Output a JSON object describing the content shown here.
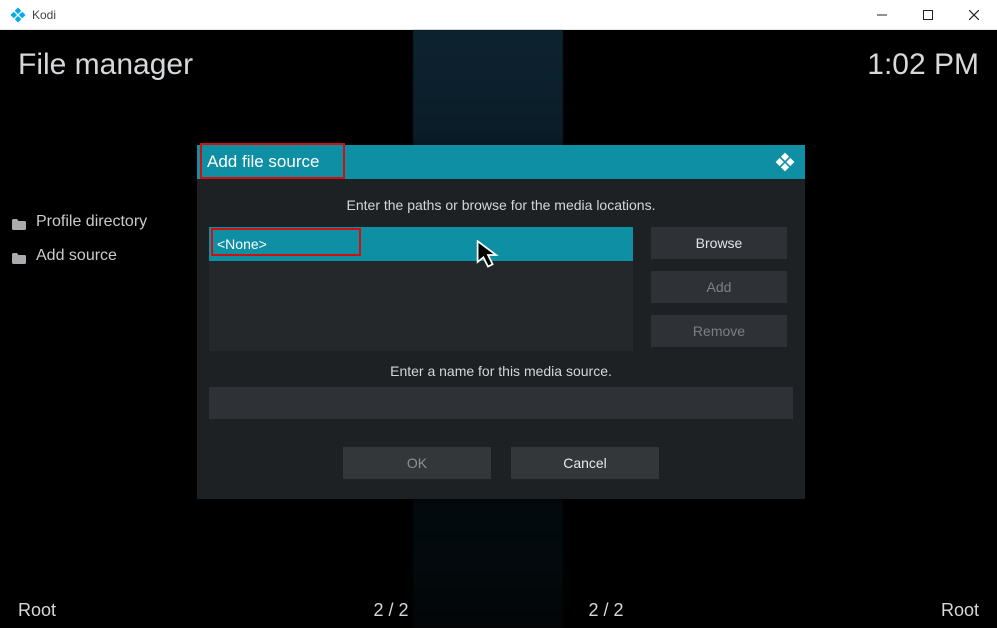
{
  "window": {
    "title": "Kodi"
  },
  "header": {
    "page_title": "File manager",
    "clock": "1:02 PM"
  },
  "side": {
    "items": [
      {
        "label": "Profile directory"
      },
      {
        "label": "Add source"
      }
    ]
  },
  "footer": {
    "left": "Root",
    "count1": "2 / 2",
    "count2": "2 / 2",
    "right": "Root"
  },
  "dialog": {
    "title": "Add file source",
    "desc": "Enter the paths or browse for the media locations.",
    "path_value": "<None>",
    "buttons": {
      "browse": "Browse",
      "add": "Add",
      "remove": "Remove"
    },
    "name_desc": "Enter a name for this media source.",
    "name_value": "",
    "ok": "OK",
    "cancel": "Cancel"
  }
}
